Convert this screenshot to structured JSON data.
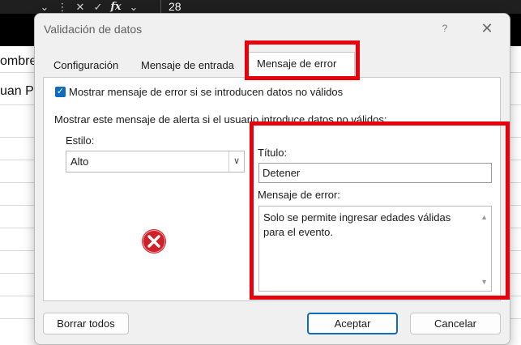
{
  "formula_bar": {
    "value": "28",
    "icons": [
      "chevron-down-icon",
      "more-options-icon",
      "cancel-x-icon",
      "check-icon",
      "fx-icon",
      "chevron-down-icon"
    ],
    "fx_label": "fx"
  },
  "sheet": {
    "cells": [
      "ombre",
      "uan Pe"
    ]
  },
  "dialog": {
    "title": "Validación de datos",
    "help": "?",
    "close": "✕",
    "tabs": [
      {
        "label": "Configuración"
      },
      {
        "label": "Mensaje de entrada"
      },
      {
        "label": "Mensaje de error"
      }
    ],
    "show_error_checkbox": {
      "label": "Mostrar mensaje de error si se introducen datos no válidos",
      "checked": true
    },
    "alert_caption": "Mostrar este mensaje de alerta si el usuario introduce datos no válidos:",
    "style": {
      "label": "Estilo:",
      "value": "Alto"
    },
    "title_field": {
      "label": "Título:",
      "value": "Detener"
    },
    "message_field": {
      "label": "Mensaje de error:",
      "value": "Solo se permite ingresar edades válidas para el evento."
    },
    "buttons": {
      "clear_all": "Borrar todos",
      "ok": "Aceptar",
      "cancel": "Cancelar"
    }
  },
  "colors": {
    "accent": "#0f6cbd",
    "highlight": "#e8000b",
    "error_icon": "#d0202a"
  }
}
